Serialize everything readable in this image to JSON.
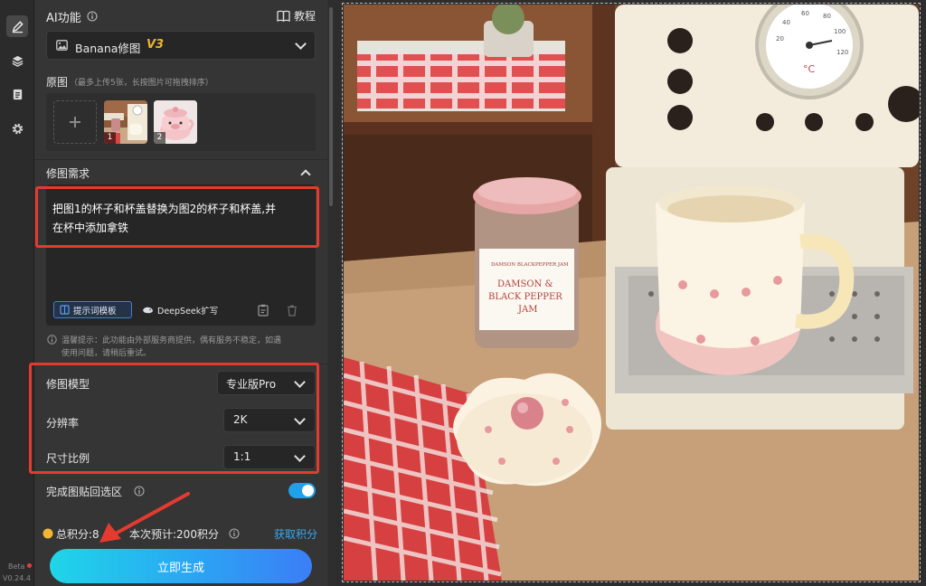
{
  "rail": {
    "items": [
      {
        "name": "edit",
        "icon": "pencil-icon",
        "active": true
      },
      {
        "name": "layers",
        "icon": "layers-icon",
        "active": false
      },
      {
        "name": "document",
        "icon": "document-icon",
        "active": false
      },
      {
        "name": "settings",
        "icon": "gear-icon",
        "active": false
      }
    ],
    "beta": "Beta",
    "version": "V0.24.4"
  },
  "header": {
    "title": "AI功能",
    "info_icon": "info-icon",
    "tutorial_label": "教程",
    "tutorial_icon": "book-icon"
  },
  "feature_select": {
    "icon": "image-icon",
    "value": "Banana修图",
    "version": "V3"
  },
  "originals": {
    "label": "原图",
    "hint": "（最多上传5张，长按图片可拖拽排序）",
    "add_icon": "plus-icon",
    "images": [
      {
        "index": "1",
        "subject": "coffee machine with cup"
      },
      {
        "index": "2",
        "subject": "pink pig mug"
      }
    ]
  },
  "requirement": {
    "label": "修图需求",
    "collapse_icon": "chevron-up-icon",
    "prompt_line1": "把图1的杯子和杯盖替换为图2的杯子和杯盖,并",
    "prompt_line2": "在杯中添加拿铁",
    "template_button": "提示词模板",
    "deepseek_button": "DeepSeek扩写",
    "tool_icons": [
      "clipboard-icon",
      "trash-icon"
    ]
  },
  "notice": {
    "line1": "温馨提示：此功能由外部服务商提供，偶有服务不稳定，如遇",
    "line2": "使用问题，请稍后重试。"
  },
  "settings": {
    "model": {
      "label": "修图模型",
      "value": "专业版Pro"
    },
    "resolution": {
      "label": "分辨率",
      "value": "2K"
    },
    "ratio": {
      "label": "尺寸比例",
      "value": "1:1"
    }
  },
  "paste_back": {
    "label": "完成图贴回选区",
    "info_icon": "info-icon",
    "enabled": true
  },
  "points": {
    "total_label": "总积分:8",
    "estimate_label": "本次预计:200积分",
    "get_points": "获取积分",
    "coin_icon": "coin-icon"
  },
  "generate_button": "立即生成",
  "colors": {
    "accent_red": "#e53a2f",
    "toggle_blue": "#1fa2e8",
    "link_blue": "#38a8f0",
    "version_gold": "#e8b730"
  },
  "canvas_photo": {
    "jar_label_line1": "DAMSON &",
    "jar_label_line2": "BLACK PEPPER",
    "jar_label_line3": "JAM",
    "jar_small_text": "DAMSON BLACKPEPPER JAM",
    "gauge_unit": "°C",
    "gauge_ticks": [
      "20",
      "40",
      "60",
      "80",
      "100",
      "120"
    ]
  }
}
